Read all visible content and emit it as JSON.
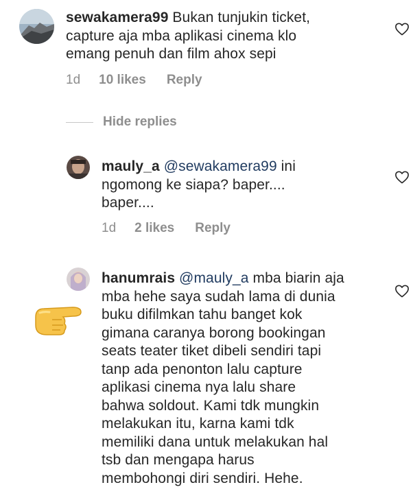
{
  "comments": [
    {
      "username": "sewakamera99",
      "lines": [
        " Bukan tunjukin ticket,",
        "capture aja mba aplikasi cinema klo",
        "emang penuh dan film ahox sepi"
      ],
      "time": "1d",
      "likes": "10 likes",
      "reply": "Reply"
    }
  ],
  "hide_replies": "Hide replies",
  "replies": [
    {
      "username": "mauly_a",
      "mention": "@sewakamera99",
      "lines": [
        " ini",
        "ngomong ke siapa? baper....",
        "baper...."
      ],
      "time": "1d",
      "likes": "2 likes",
      "reply": "Reply"
    },
    {
      "username": "hanumrais",
      "mention": "@mauly_a",
      "lines": [
        " mba biarin aja",
        "mba hehe saya sudah lama di dunia",
        "buku difilmkan tahu banget kok",
        "gimana caranya borong bookingan",
        "seats teater tiket dibeli sendiri tapi",
        "tanp ada penonton lalu capture",
        "aplikasi cinema nya lalu share",
        "bahwa soldout. Kami tdk mungkin",
        "melakukan itu, karna kami tdk",
        "memiliki dana untuk melakukan hal",
        "tsb dan mengapa harus",
        "membohongi diri sendiri. Hehe."
      ]
    }
  ],
  "icons": {
    "like": "heart-outline-icon",
    "pointer": "backhand-index-pointing-right-emoji"
  }
}
